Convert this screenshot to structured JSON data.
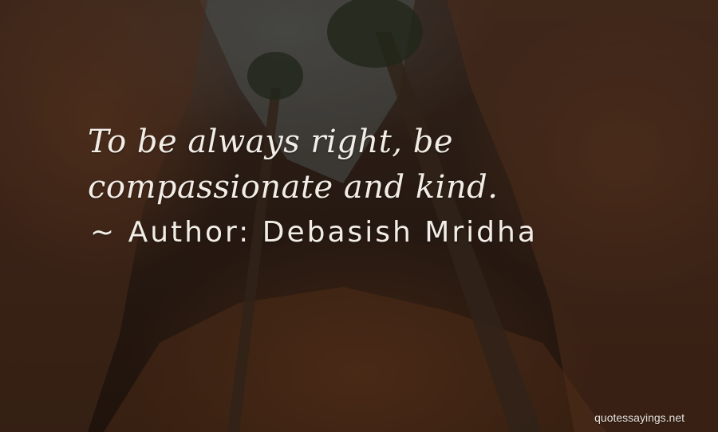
{
  "quote": {
    "text": "To be always right, be compassionate and kind.",
    "author_line": "~ Author: Debasish Mridha"
  },
  "watermark": {
    "text": "quotessayings.net"
  },
  "colors": {
    "text": "#f2ede6",
    "background_rock": "#2e1f16",
    "sky": "#6f7a78"
  }
}
